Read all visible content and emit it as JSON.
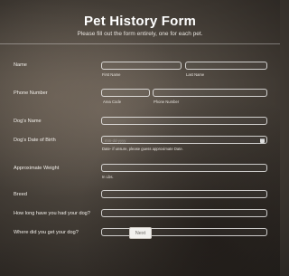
{
  "form": {
    "title": "Pet History Form",
    "subtitle": "Please fill out the form entirely, one for each pet."
  },
  "fields": {
    "name": {
      "label": "Name",
      "first_sub": "First Name",
      "last_sub": "Last Name"
    },
    "phone": {
      "label": "Phone Number",
      "area_sub": "Area Code",
      "number_sub": "Phone Number"
    },
    "dog_name": {
      "label": "Dog's Name"
    },
    "dob": {
      "label": "Dog's Date of Birth",
      "placeholder": "mm-dd-yyyy",
      "hint": "Date- if unsure, please guess approximate Date.",
      "icon": "calendar-icon"
    },
    "weight": {
      "label": "Approximate Weight",
      "unit": "In Lbs."
    },
    "breed": {
      "label": "Breed"
    },
    "how_long": {
      "label": "How long have you had your dog?"
    },
    "where": {
      "label": "Where did you get your dog?"
    }
  },
  "buttons": {
    "next": "Next"
  },
  "colors": {
    "required_marker": "#e57a6e",
    "button_bg": "#f1f0ee"
  }
}
